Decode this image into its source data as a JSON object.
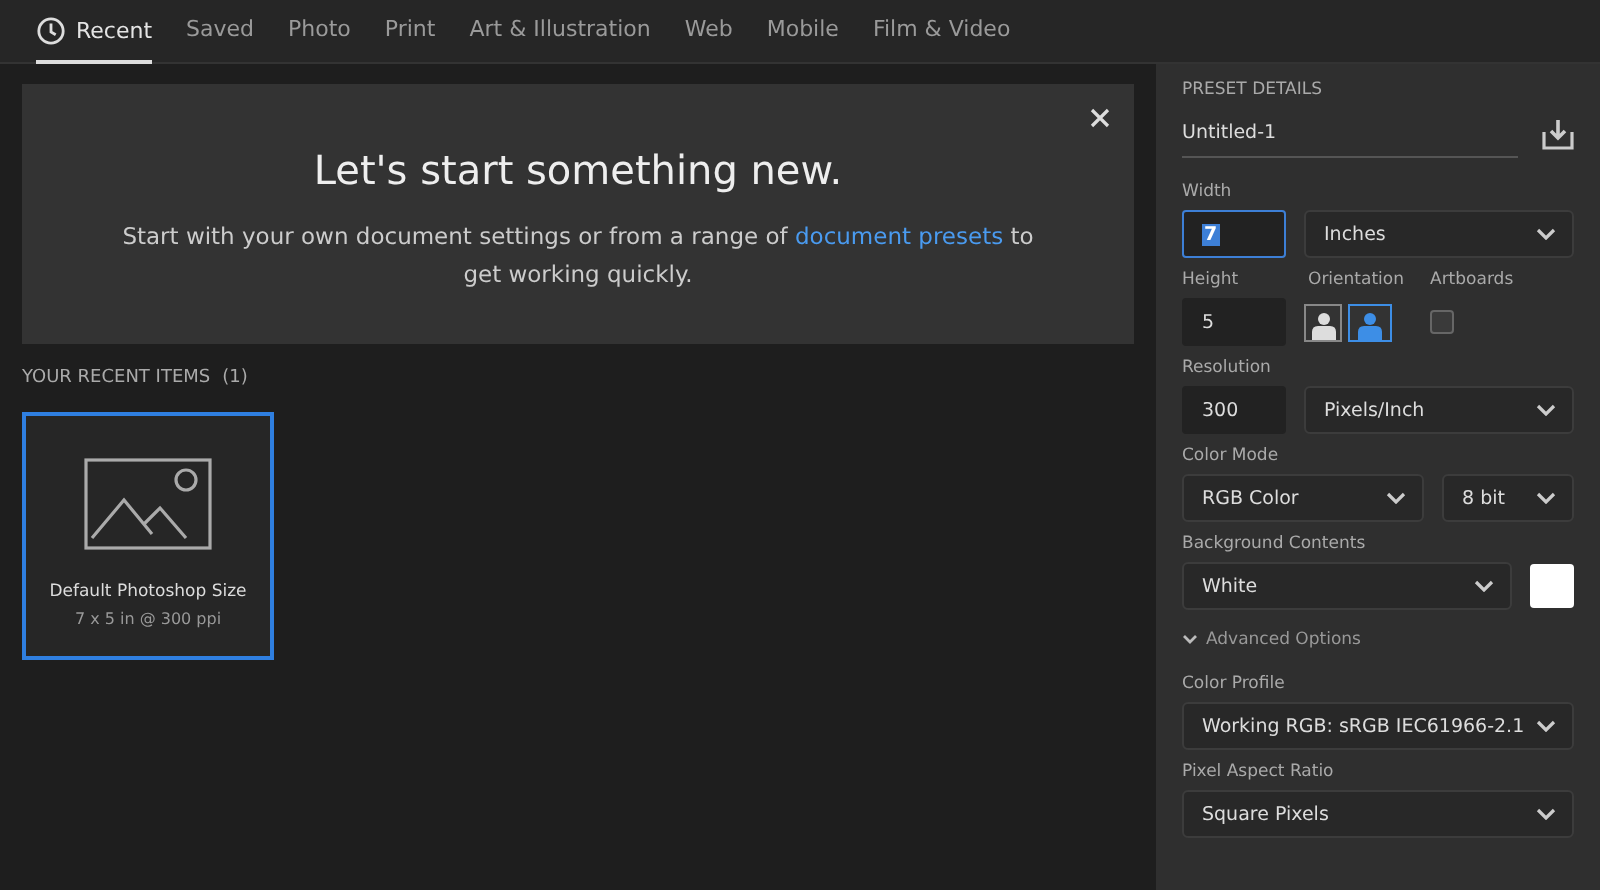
{
  "tabs": [
    {
      "label": "Recent",
      "kind": "with-icon",
      "selected": true
    },
    {
      "label": "Saved",
      "kind": "plain",
      "selected": false
    },
    {
      "label": "Photo",
      "kind": "plain",
      "selected": false
    },
    {
      "label": "Print",
      "kind": "plain",
      "selected": false
    },
    {
      "label": "Art & Illustration",
      "kind": "plain",
      "selected": false
    },
    {
      "label": "Web",
      "kind": "plain",
      "selected": false
    },
    {
      "label": "Mobile",
      "kind": "plain",
      "selected": false
    },
    {
      "label": "Film & Video",
      "kind": "plain",
      "selected": false
    }
  ],
  "hero": {
    "title": "Let's start something new.",
    "text_before": "Start with your own document settings or from a range of",
    "link": "document presets",
    "text_after": "to get working quickly."
  },
  "recent": {
    "heading": "YOUR RECENT ITEMS",
    "count": "(1)",
    "items": [
      {
        "name": "Default Photoshop Size",
        "detail": "7 x 5 in @ 300 ppi",
        "selected": true
      }
    ]
  },
  "preset": {
    "heading": "PRESET DETAILS",
    "name": "Untitled-1",
    "width": {
      "label": "Width",
      "value": "7",
      "focused": true,
      "unit": "Inches"
    },
    "height": {
      "label": "Height",
      "value": "5"
    },
    "orientation": {
      "label": "Orientation",
      "options": [
        {
          "kind": "portrait",
          "selected": false
        },
        {
          "kind": "landscape",
          "selected": true
        }
      ]
    },
    "artboards": {
      "label": "Artboards",
      "checked": false
    },
    "resolution": {
      "label": "Resolution",
      "value": "300",
      "unit": "Pixels/Inch"
    },
    "color_mode": {
      "label": "Color Mode",
      "mode": "RGB Color",
      "depth": "8 bit"
    },
    "background": {
      "label": "Background Contents",
      "value": "White",
      "color": "#ffffff"
    },
    "advanced": {
      "label": "Advanced Options",
      "expanded": true
    },
    "color_profile": {
      "label": "Color Profile",
      "value": "Working RGB: sRGB IEC61966-2.1"
    },
    "pixel_aspect": {
      "label": "Pixel Aspect Ratio",
      "value": "Square Pixels"
    }
  }
}
